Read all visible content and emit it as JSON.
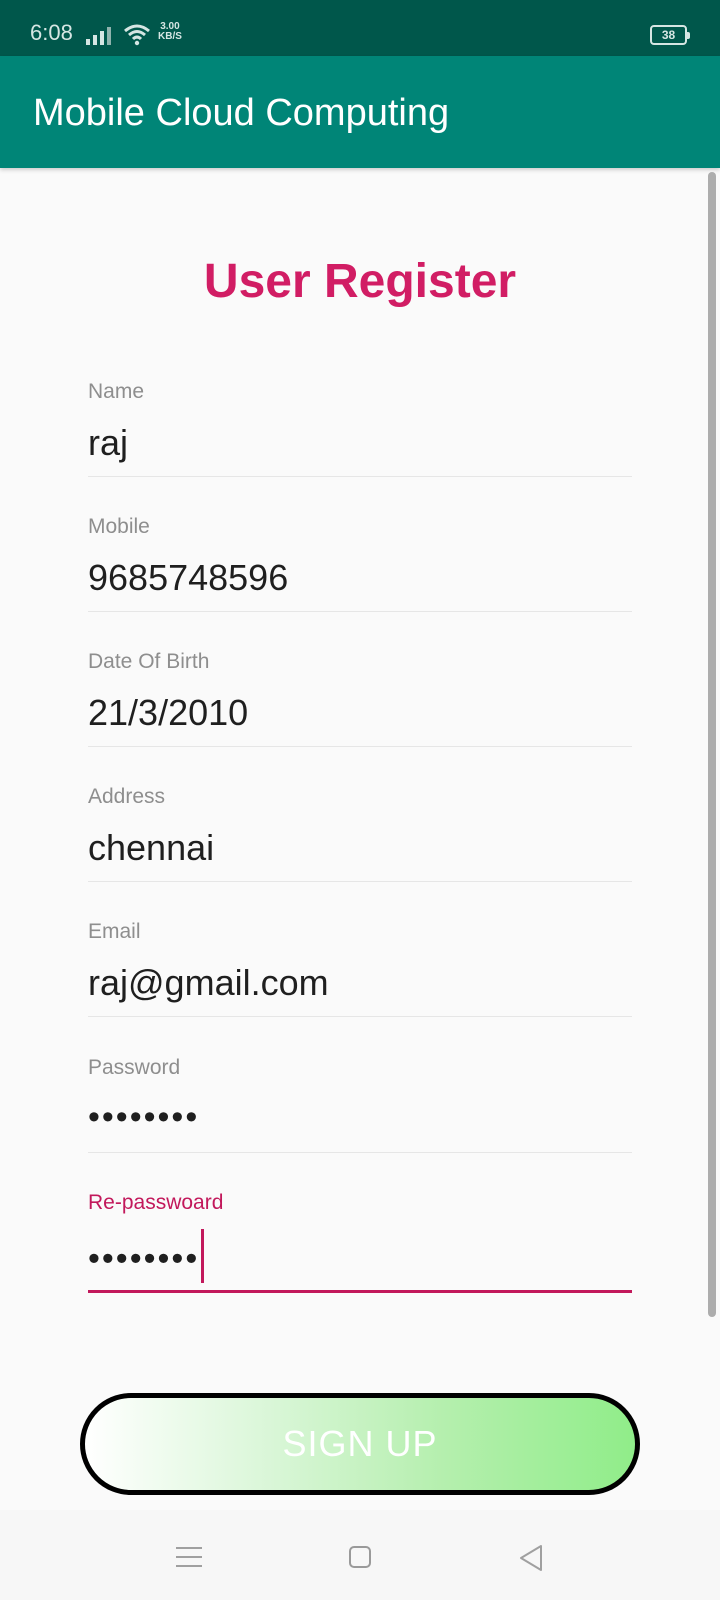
{
  "status_bar": {
    "time": "6:08",
    "net_speed_value": "3.00",
    "net_speed_unit": "KB/S",
    "battery": "38",
    "icons": [
      "signal-icon",
      "wifi-icon",
      "battery-icon"
    ]
  },
  "app_bar": {
    "title": "Mobile Cloud Computing",
    "color": "#008577"
  },
  "form": {
    "heading": "User Register",
    "heading_color": "#D11D64",
    "fields": [
      {
        "label": "Name",
        "value": "raj"
      },
      {
        "label": "Mobile",
        "value": "9685748596"
      },
      {
        "label": "Date Of Birth",
        "value": "21/3/2010"
      },
      {
        "label": "Address",
        "value": "chennai"
      },
      {
        "label": "Email",
        "value": "raj@gmail.com"
      },
      {
        "label": "Password",
        "value": "••••••••"
      },
      {
        "label": "Re-passwoard",
        "value": "••••••••"
      }
    ],
    "active_field": "Re-passwoard",
    "accent_color": "#C2185B",
    "submit_label": "SIGN UP"
  },
  "nav_bar": {
    "icons": [
      "menu-icon",
      "home-icon",
      "back-icon"
    ]
  }
}
